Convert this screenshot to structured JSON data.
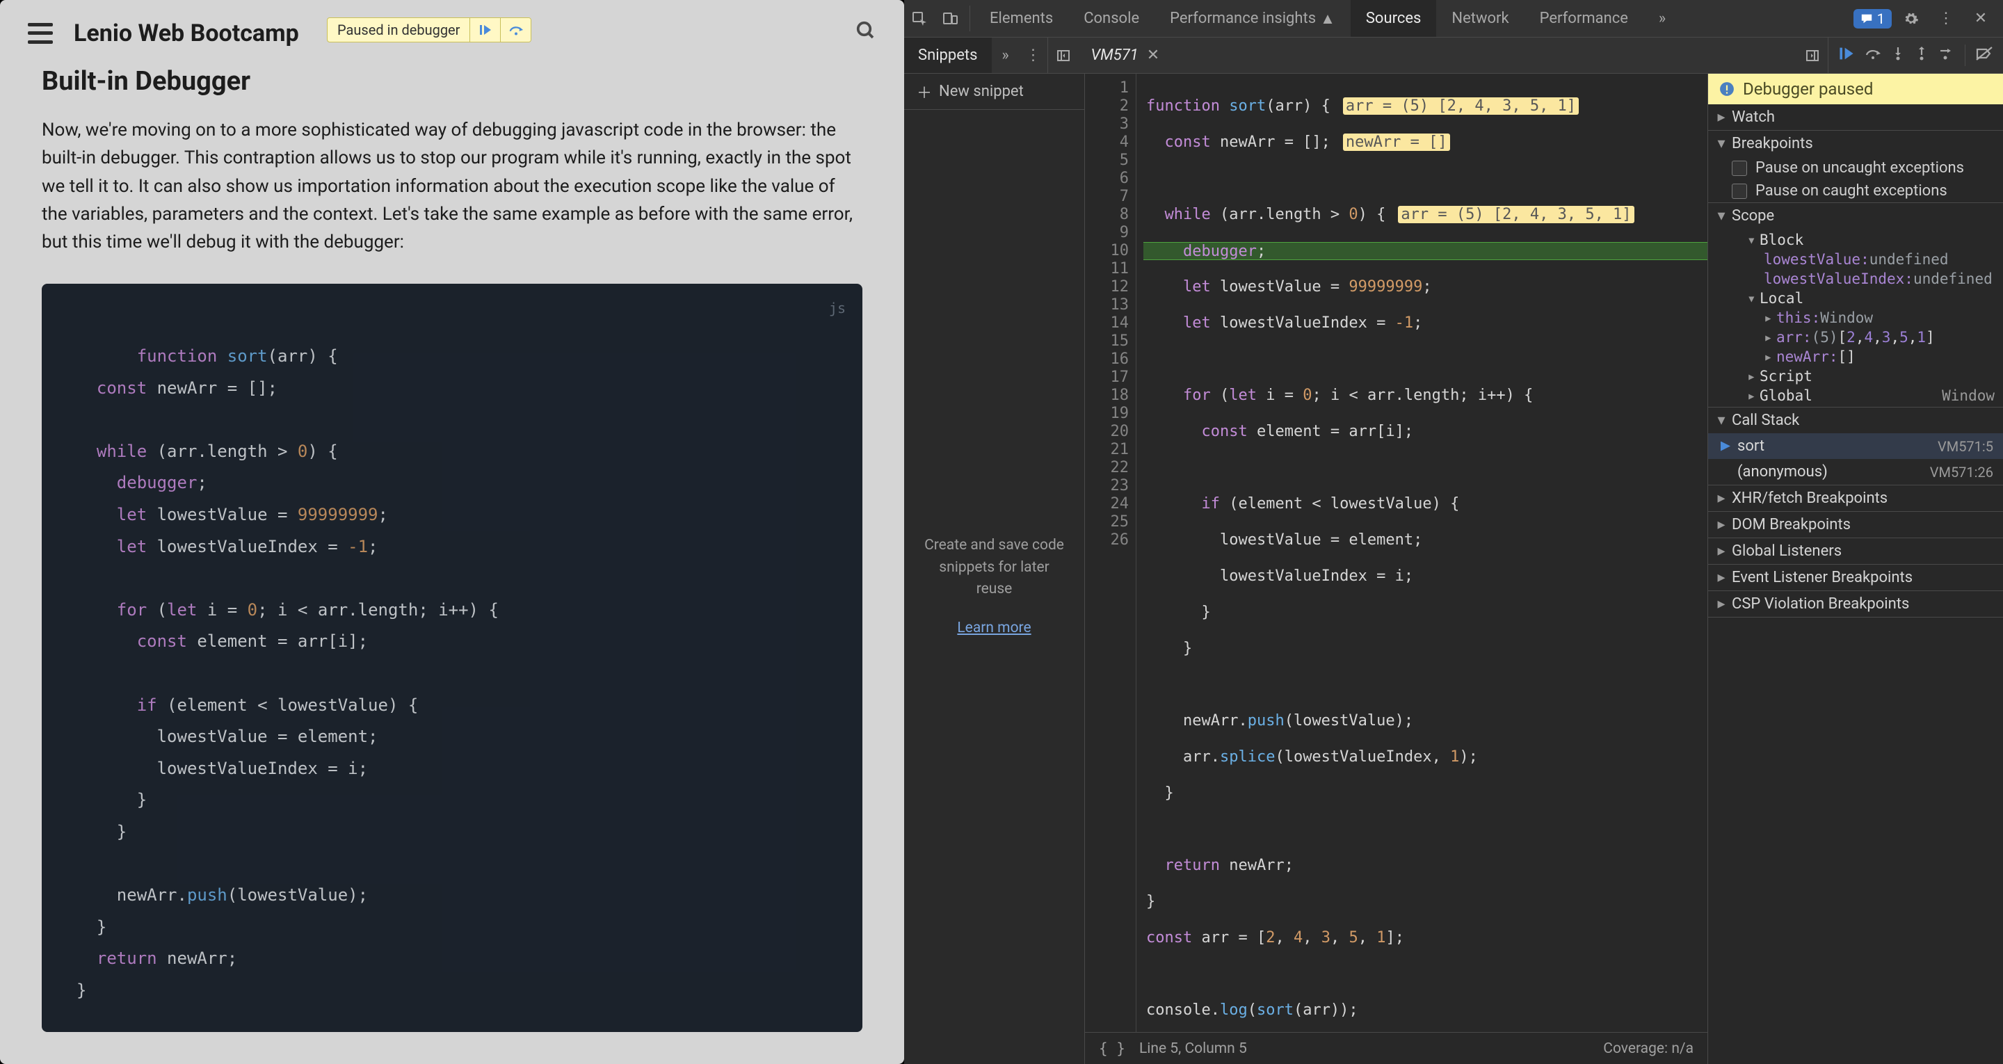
{
  "page": {
    "brand": "Lenio Web Bootcamp",
    "heading": "Built-in Debugger",
    "paragraph": "Now, we're moving on to a more sophisticated way of debugging javascript code in the browser: the built-in debugger. This contraption allows us to stop our program while it's running, exactly in the spot we tell it to. It can also show us importation information about the execution scope like the value of the variables, parameters and the context. Let's take the same example as before with the same error, but this time we'll debug it with the debugger:",
    "code_lang": "js"
  },
  "paused_bar": {
    "label": "Paused in debugger"
  },
  "devtools": {
    "tabs": [
      "Elements",
      "Console",
      "Performance insights",
      "Sources",
      "Network",
      "Performance"
    ],
    "active_tab": "Sources",
    "message_count": "1",
    "subtab": "Snippets",
    "file_tab": "VM571",
    "new_snippet": "New snippet",
    "snippet_placeholder": "Create and save code snippets for later reuse",
    "learn_more": "Learn more",
    "status_line": "Line 5, Column 5",
    "coverage": "Coverage: n/a",
    "inline_val_1": "arr = (5) [2, 4, 3, 5, 1]",
    "inline_val_2": "newArr = []",
    "inline_val_4": "arr = (5) [2, 4, 3, 5, 1]"
  },
  "debugger": {
    "banner": "Debugger paused",
    "watch": "Watch",
    "breakpoints": "Breakpoints",
    "pause_uncaught": "Pause on uncaught exceptions",
    "pause_caught": "Pause on caught exceptions",
    "scope": "Scope",
    "block": "Block",
    "lowestValue_label": "lowestValue:",
    "lowestValue_val": "undefined",
    "lowestValueIndex_label": "lowestValueIndex:",
    "lowestValueIndex_val": "undefined",
    "local": "Local",
    "this_label": "this:",
    "this_val": "Window",
    "arr_label": "arr:",
    "arr_count": "(5)",
    "arr_vals": "[2, 4, 3, 5, 1]",
    "newArr_label": "newArr:",
    "newArr_val": "[]",
    "script": "Script",
    "global": "Global",
    "global_val": "Window",
    "callstack": "Call Stack",
    "call1_name": "sort",
    "call1_loc": "VM571:5",
    "call2_name": "(anonymous)",
    "call2_loc": "VM571:26",
    "xhr": "XHR/fetch Breakpoints",
    "dom": "DOM Breakpoints",
    "listeners": "Global Listeners",
    "event_bp": "Event Listener Breakpoints",
    "csp": "CSP Violation Breakpoints"
  }
}
